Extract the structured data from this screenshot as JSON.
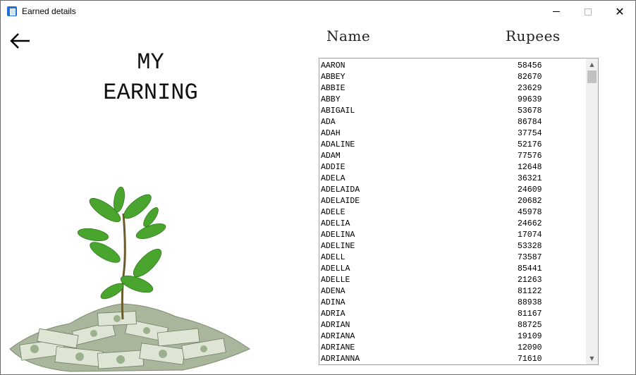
{
  "window": {
    "title": "Earned details",
    "icon": "app-window-icon"
  },
  "controls": {
    "minimize": "minimize-icon",
    "maximize": "maximize-icon",
    "close": "close-icon",
    "close_glyph": "✕"
  },
  "back": {
    "icon": "back-arrow-icon"
  },
  "heading": {
    "line1": "MY",
    "line2": "EARNING"
  },
  "columns": {
    "name": "Name",
    "rupees": "Rupees"
  },
  "earnings": [
    {
      "name": "AARON",
      "rupees": "58456"
    },
    {
      "name": "ABBEY",
      "rupees": "82670"
    },
    {
      "name": "ABBIE",
      "rupees": "23629"
    },
    {
      "name": "ABBY",
      "rupees": "99639"
    },
    {
      "name": "ABIGAIL",
      "rupees": "53678"
    },
    {
      "name": "ADA",
      "rupees": "86784"
    },
    {
      "name": "ADAH",
      "rupees": "37754"
    },
    {
      "name": "ADALINE",
      "rupees": "52176"
    },
    {
      "name": "ADAM",
      "rupees": "77576"
    },
    {
      "name": "ADDIE",
      "rupees": "12648"
    },
    {
      "name": "ADELA",
      "rupees": "36321"
    },
    {
      "name": "ADELAIDA",
      "rupees": "24609"
    },
    {
      "name": "ADELAIDE",
      "rupees": "20682"
    },
    {
      "name": "ADELE",
      "rupees": "45978"
    },
    {
      "name": "ADELIA",
      "rupees": "24662"
    },
    {
      "name": "ADELINA",
      "rupees": "17074"
    },
    {
      "name": "ADELINE",
      "rupees": "53328"
    },
    {
      "name": "ADELL",
      "rupees": "73587"
    },
    {
      "name": "ADELLA",
      "rupees": "85441"
    },
    {
      "name": "ADELLE",
      "rupees": "21263"
    },
    {
      "name": "ADENA",
      "rupees": "81122"
    },
    {
      "name": "ADINA",
      "rupees": "88938"
    },
    {
      "name": "ADRIA",
      "rupees": "81167"
    },
    {
      "name": "ADRIAN",
      "rupees": "88725"
    },
    {
      "name": "ADRIANA",
      "rupees": "19109"
    },
    {
      "name": "ADRIANE",
      "rupees": "12090"
    },
    {
      "name": "ADRIANNA",
      "rupees": "71610"
    }
  ],
  "scrollbar": {
    "up_glyph": "▲",
    "down_glyph": "▼"
  },
  "colors": {
    "plant_green": "#4aa52e",
    "money_green": "#9fb38e",
    "icon_blue": "#1f6fd9"
  }
}
